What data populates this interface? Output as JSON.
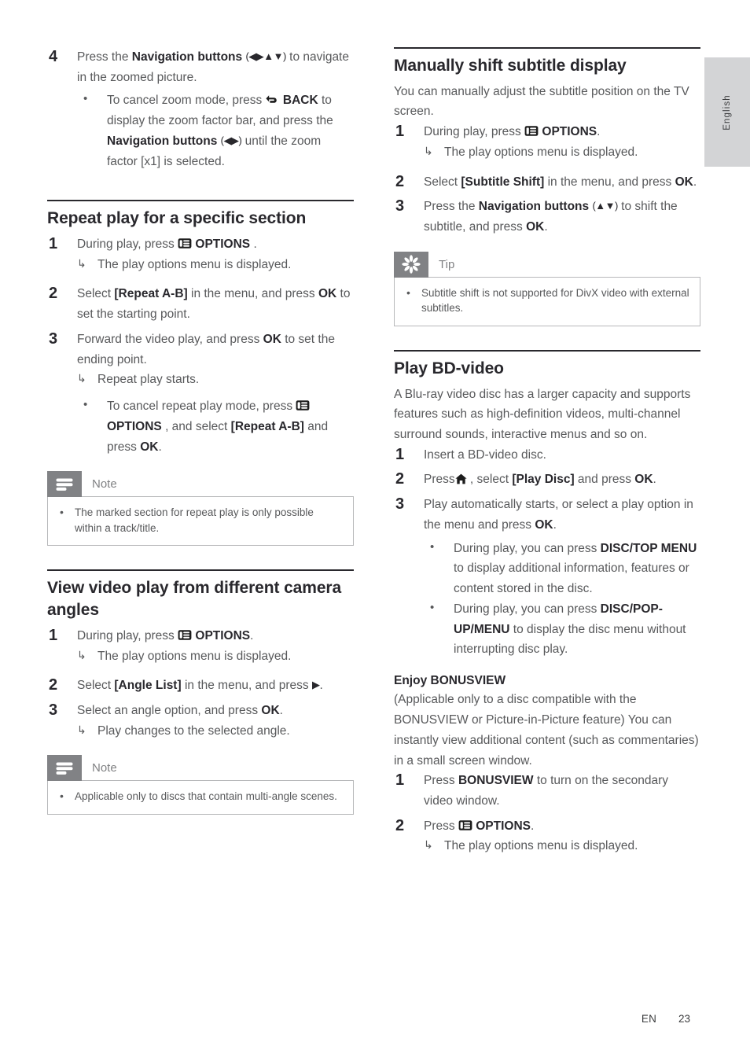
{
  "side_tab": {
    "language": "English"
  },
  "footer": {
    "locale": "EN",
    "page_number": "23"
  },
  "icons": {
    "options": "options-icon",
    "back": "back-arrow-icon",
    "home": "home-icon",
    "note": "note-icon",
    "tip": "tip-asterisk-icon",
    "arrow_result": "↳",
    "bullet": "•"
  },
  "left_column": {
    "step4": {
      "number": "4",
      "text_before": "Press the ",
      "bold_nav": "Navigation buttons",
      "glyph": "(◀▶▲▼)",
      "text_after": " to navigate in the zoomed picture.",
      "bullet": {
        "part1": "To cancel zoom mode, press ",
        "bold_back": "BACK",
        "part2": " to display the zoom factor bar, and press the ",
        "bold_nav": "Navigation buttons",
        "glyph2": "(◀▶)",
        "part3": " until the zoom factor [x1] is selected."
      }
    },
    "repeat_section": {
      "title": "Repeat play for a specific section",
      "steps": [
        {
          "number": "1",
          "text_before": "During play, press ",
          "bold": "OPTIONS",
          "text_after": " .",
          "result": "The play options menu is displayed."
        },
        {
          "number": "2",
          "part1": "Select ",
          "bold1": "[Repeat A-B]",
          "part2": " in the menu, and press ",
          "bold2": "OK",
          "part3": " to set the starting point."
        },
        {
          "number": "3",
          "part1": "Forward the video play, and press ",
          "bold1": "OK",
          "part2": " to set the ending point.",
          "result": "Repeat play starts.",
          "bullet": {
            "part1": "To cancel repeat play mode, press ",
            "bold1": "OPTIONS",
            "part2": " , and select ",
            "bold2": "[Repeat A-B]",
            "part3": " and press ",
            "bold3": "OK",
            "part4": "."
          }
        }
      ],
      "note": {
        "label": "Note",
        "body": "The marked section for repeat play is only possible within a track/title."
      }
    },
    "angles_section": {
      "title": "View video play from different camera angles",
      "steps": [
        {
          "number": "1",
          "text_before": "During play, press ",
          "bold": "OPTIONS",
          "text_after": ".",
          "result": "The play options menu is displayed."
        },
        {
          "number": "2",
          "part1": "Select ",
          "bold1": "[Angle List]",
          "part2": " in the menu, and press ",
          "glyph": "▶",
          "part3": "."
        },
        {
          "number": "3",
          "part1": "Select an angle option, and press ",
          "bold1": "OK",
          "part2": ".",
          "result": "Play changes to the selected angle."
        }
      ],
      "note": {
        "label": "Note",
        "body": "Applicable only to discs that contain multi-angle scenes."
      }
    }
  },
  "right_column": {
    "subtitle_section": {
      "title": "Manually shift subtitle display",
      "intro": "You can manually adjust the subtitle position on the TV screen.",
      "steps": [
        {
          "number": "1",
          "text_before": "During play, press ",
          "bold": "OPTIONS",
          "text_after": ".",
          "result": "The play options menu is displayed."
        },
        {
          "number": "2",
          "part1": "Select ",
          "bold1": "[Subtitle Shift]",
          "part2": " in the menu, and press ",
          "bold2": "OK",
          "part3": "."
        },
        {
          "number": "3",
          "part1": "Press the ",
          "bold1": "Navigation buttons",
          "glyph": "(▲▼)",
          "part2": " to shift the subtitle, and press ",
          "bold2": "OK",
          "part3": "."
        }
      ],
      "tip": {
        "label": "Tip",
        "body": "Subtitle shift is not supported for DivX video with external subtitles."
      }
    },
    "bdvideo_section": {
      "title": "Play BD-video",
      "intro": "A Blu-ray video disc has a larger capacity and supports features such as high-definition videos, multi-channel surround sounds, interactive menus and so on.",
      "steps": [
        {
          "number": "1",
          "text": "Insert a BD-video disc."
        },
        {
          "number": "2",
          "part1": "Press",
          "part2": " , select ",
          "bold1": "[Play Disc]",
          "part3": " and press ",
          "bold2": "OK",
          "part4": "."
        },
        {
          "number": "3",
          "part1": "Play automatically starts, or select a play option in the menu and press ",
          "bold1": "OK",
          "part2": ".",
          "bullets": [
            {
              "part1": "During play, you can press ",
              "bold1": "DISC/TOP MENU",
              "part2": " to display additional information, features or content stored in the disc."
            },
            {
              "part1": "During play, you can press ",
              "bold1": "DISC/POP-UP/MENU",
              "part2": " to display the disc menu without interrupting disc play."
            }
          ]
        }
      ]
    },
    "bonusview_section": {
      "title": "Enjoy BONUSVIEW",
      "intro": "(Applicable only to a disc compatible with the BONUSVIEW or Picture-in-Picture feature) You can instantly view additional content (such as commentaries) in a small screen window.",
      "steps": [
        {
          "number": "1",
          "part1": "Press ",
          "bold1": "BONUSVIEW",
          "part2": " to turn on the secondary video window."
        },
        {
          "number": "2",
          "part1": "Press ",
          "bold1": "OPTIONS",
          "part2": ".",
          "result": "The play options menu is displayed."
        }
      ]
    }
  }
}
